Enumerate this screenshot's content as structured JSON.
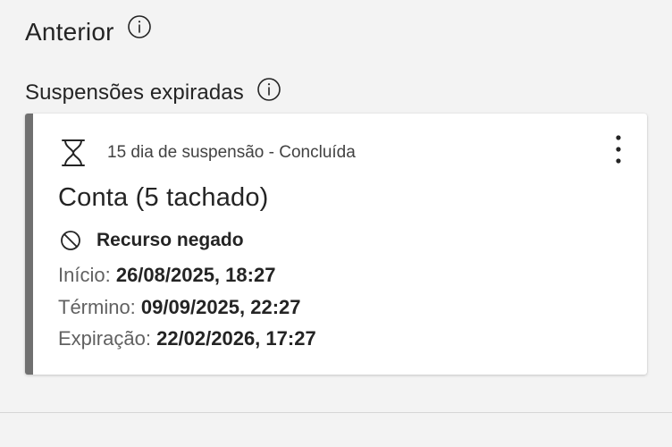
{
  "sections": {
    "previous": {
      "title": "Anterior"
    },
    "expired": {
      "title": "Suspensões expiradas"
    }
  },
  "card": {
    "accent_color": "#707070",
    "status": "15 dia de suspensão - Concluída",
    "title": "Conta (5 tachado)",
    "decision": "Recurso negado",
    "start_label": "Início:",
    "start_value": "26/08/2025, 18:27",
    "end_label": "Término:",
    "end_value": "09/09/2025, 22:27",
    "expiration_label": "Expiração:",
    "expiration_value": "22/02/2026, 17:27"
  },
  "icons": {
    "info": "info-icon",
    "hourglass": "hourglass-icon",
    "more": "more-vertical-icon",
    "blocked": "block-icon"
  }
}
